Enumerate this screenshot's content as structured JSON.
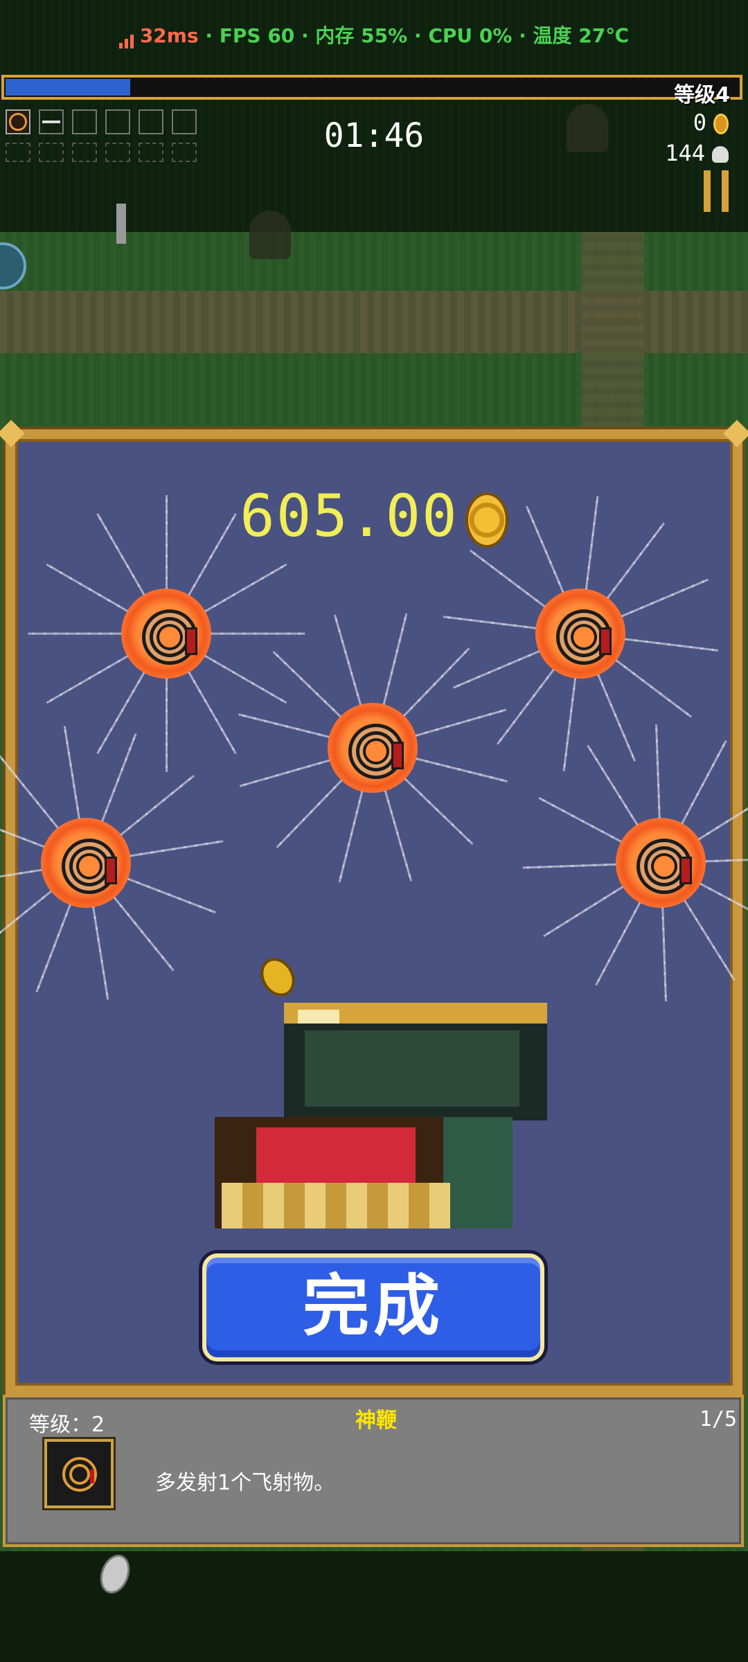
{
  "status_bar": {
    "latency": "32ms",
    "rest": " · FPS 60 · 内存 55% · CPU 0% · 温度 27℃"
  },
  "hud": {
    "xp_fraction": 0.17,
    "level_label": "等级4",
    "timer": "01:46",
    "gold": "0",
    "kills": "144",
    "weapon_slots": [
      "whip-icon",
      "knife-icon",
      "",
      "",
      "",
      ""
    ],
    "passive_slots": 6
  },
  "chest": {
    "amount": "605.00",
    "orbs": 5,
    "done_label": "完成"
  },
  "item_info": {
    "level_label": "等级：2",
    "name": "神鞭",
    "count": "1/5",
    "icon": "whip-icon",
    "description": "多发射1个飞射物。"
  },
  "colors": {
    "accent_gold": "#c9983e",
    "xp_blue": "#2d63ce",
    "button_blue": "#2f5ee6",
    "amount_yellow": "#f2ee56",
    "name_yellow": "#ffe500"
  }
}
